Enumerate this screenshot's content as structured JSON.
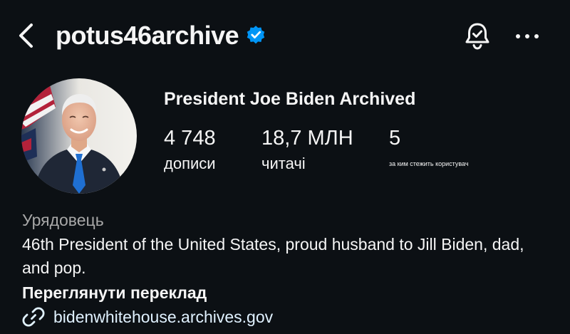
{
  "header": {
    "username": "potus46archive",
    "back_icon": "chevron-left-icon",
    "verified_icon": "verified-badge-icon",
    "bell_icon": "notification-bell-icon",
    "more_icon": "more-horizontal-icon"
  },
  "profile": {
    "display_name": "President Joe Biden Archived",
    "stats": {
      "posts": {
        "value": "4 748",
        "label": "дописи"
      },
      "followers": {
        "value": "18,7 МЛН",
        "label": "читачі"
      },
      "following": {
        "value": "5",
        "label": "за ким стежить користувач"
      }
    },
    "category": "Урядовець",
    "bio": "46th President of the United States, proud husband to Jill Biden, dad, and pop.",
    "translate_label": "Переглянути переклад",
    "link_icon": "link-icon",
    "link_text": "bidenwhitehouse.archives.gov"
  },
  "colors": {
    "background": "#0c1014",
    "text": "#f5f5f5",
    "secondary_text": "#a8a8a8",
    "link": "#e0f1ff",
    "verified": "#0095f6"
  }
}
